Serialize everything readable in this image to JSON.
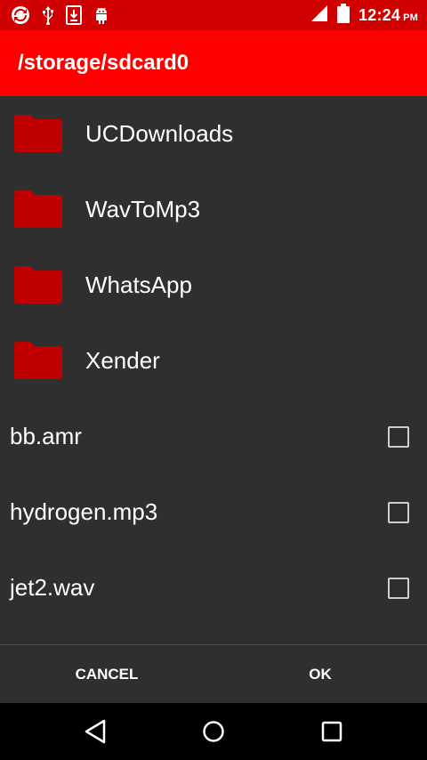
{
  "status_bar": {
    "time": "12:24",
    "ampm": "PM",
    "icons": [
      "sync-icon",
      "usb-icon",
      "download-icon",
      "android-debug-icon",
      "signal-icon",
      "battery-icon"
    ]
  },
  "app_bar": {
    "title": "/storage/sdcard0",
    "color": "#ff0000"
  },
  "folders": [
    {
      "name": "UCDownloads"
    },
    {
      "name": "WavToMp3"
    },
    {
      "name": "WhatsApp"
    },
    {
      "name": "Xender"
    }
  ],
  "files": [
    {
      "name": "bb.amr",
      "checked": false
    },
    {
      "name": "hydrogen.mp3",
      "checked": false
    },
    {
      "name": "jet2.wav",
      "checked": false
    }
  ],
  "buttons": {
    "cancel": "CANCEL",
    "ok": "OK"
  },
  "nav": {
    "icons": [
      "back-icon",
      "home-icon",
      "recent-apps-icon"
    ]
  }
}
